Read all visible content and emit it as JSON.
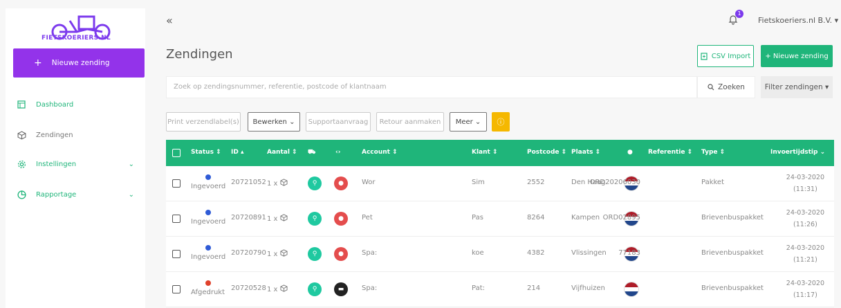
{
  "brand": {
    "logo_text": "FIETSKOERIERS.NL",
    "color": "#7c3aed"
  },
  "sidebar": {
    "new_button": "Nieuwe zending",
    "items": [
      {
        "label": "Dashboard",
        "icon": "dashboard-icon"
      },
      {
        "label": "Zendingen",
        "icon": "package-icon"
      },
      {
        "label": "Instellingen",
        "icon": "gear-icon"
      },
      {
        "label": "Rapportage",
        "icon": "chart-pie-icon"
      }
    ]
  },
  "topbar": {
    "collapse": "«",
    "notifications": "1",
    "company": "Fietskoeriers.nl B.V."
  },
  "page": {
    "title": "Zendingen",
    "csv_import": "CSV Import",
    "new_shipment": "+ Nieuwe zending",
    "search_placeholder": "Zoek op zendingsnummer, referentie, postcode of klantnaam",
    "search_button": "Zoeken",
    "filter_button": "Filter zendingen"
  },
  "toolbar": {
    "print": "Print verzendlabel(s)",
    "edit": "Bewerken",
    "support": "Supportaanvraag",
    "return": "Retour aanmaken",
    "more": "Meer"
  },
  "table": {
    "headers": {
      "status": "Status",
      "id": "ID",
      "amount": "Aantal",
      "account": "Account",
      "client": "Klant",
      "postcode": "Postcode",
      "city": "Plaats",
      "reference": "Referentie",
      "type": "Type",
      "entry_time": "Invoertijdstip"
    },
    "rows": [
      {
        "status": "Ingevoerd",
        "status_color": "#2f5bd6",
        "id": "20721052",
        "amount": "1 x",
        "account": "Wor",
        "client": "Sim",
        "postcode": "2552",
        "city": "Den Haag",
        "reference": "ORD20206030",
        "type": "Pakket",
        "date": "24-03-2020",
        "time": "(11:31)",
        "carrier_dark": false
      },
      {
        "status": "Ingevoerd",
        "status_color": "#2f5bd6",
        "id": "20720891",
        "amount": "1 x",
        "account": "Pet",
        "client": "Pas",
        "postcode": "8264",
        "city": "Kampen",
        "reference": "ORD02895",
        "type": "Brievenbuspakket",
        "date": "24-03-2020",
        "time": "(11:26)",
        "carrier_dark": false
      },
      {
        "status": "Ingevoerd",
        "status_color": "#2f5bd6",
        "id": "20720790",
        "amount": "1 x",
        "account": "Spa:",
        "client": "koe",
        "postcode": "4382",
        "city": "Vlissingen",
        "reference": "77183",
        "type": "Brievenbuspakket",
        "date": "24-03-2020",
        "time": "(11:21)",
        "carrier_dark": false
      },
      {
        "status": "Afgedrukt",
        "status_color": "#e0412b",
        "id": "20720528",
        "amount": "1 x",
        "account": "Spa:",
        "client": "Pat:",
        "postcode": "214",
        "city": "Vijfhuizen",
        "reference": "",
        "type": "Brievenbuspakket",
        "date": "24-03-2020",
        "time": "(11:17)",
        "carrier_dark": true
      }
    ]
  },
  "colors": {
    "green": "#1fb57a",
    "purple": "#9333ea",
    "warning": "#f5b800",
    "red_drop": "#e44d4d"
  }
}
